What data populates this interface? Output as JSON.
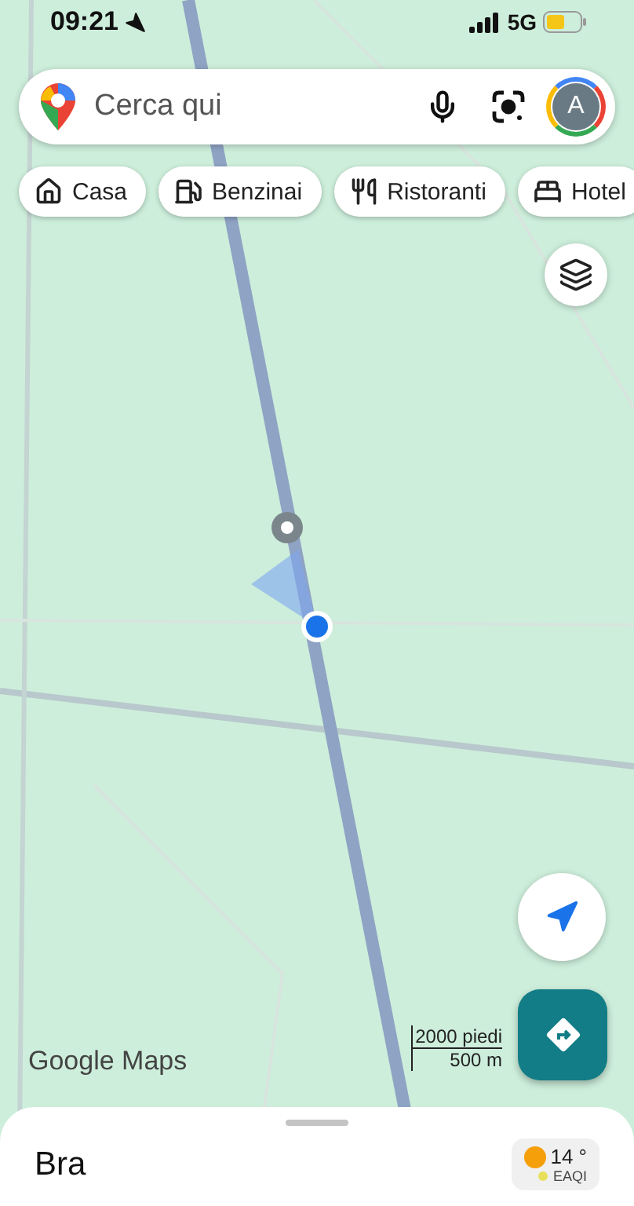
{
  "status_bar": {
    "time": "09:21",
    "network": "5G"
  },
  "search": {
    "placeholder": "Cerca qui",
    "avatar_letter": "A"
  },
  "chips": [
    {
      "label": "Casa",
      "kind": "home"
    },
    {
      "label": "Benzinai",
      "kind": "fuel"
    },
    {
      "label": "Ristoranti",
      "kind": "restaurant"
    },
    {
      "label": "Hotel",
      "kind": "hotel"
    }
  ],
  "map": {
    "logo": "Google Maps",
    "scale": {
      "imperial": "2000 piedi",
      "metric": "500 m"
    }
  },
  "bottom_sheet": {
    "title": "Bra",
    "weather": {
      "temperature": "14 °",
      "aqi_label": "EAQI"
    }
  }
}
